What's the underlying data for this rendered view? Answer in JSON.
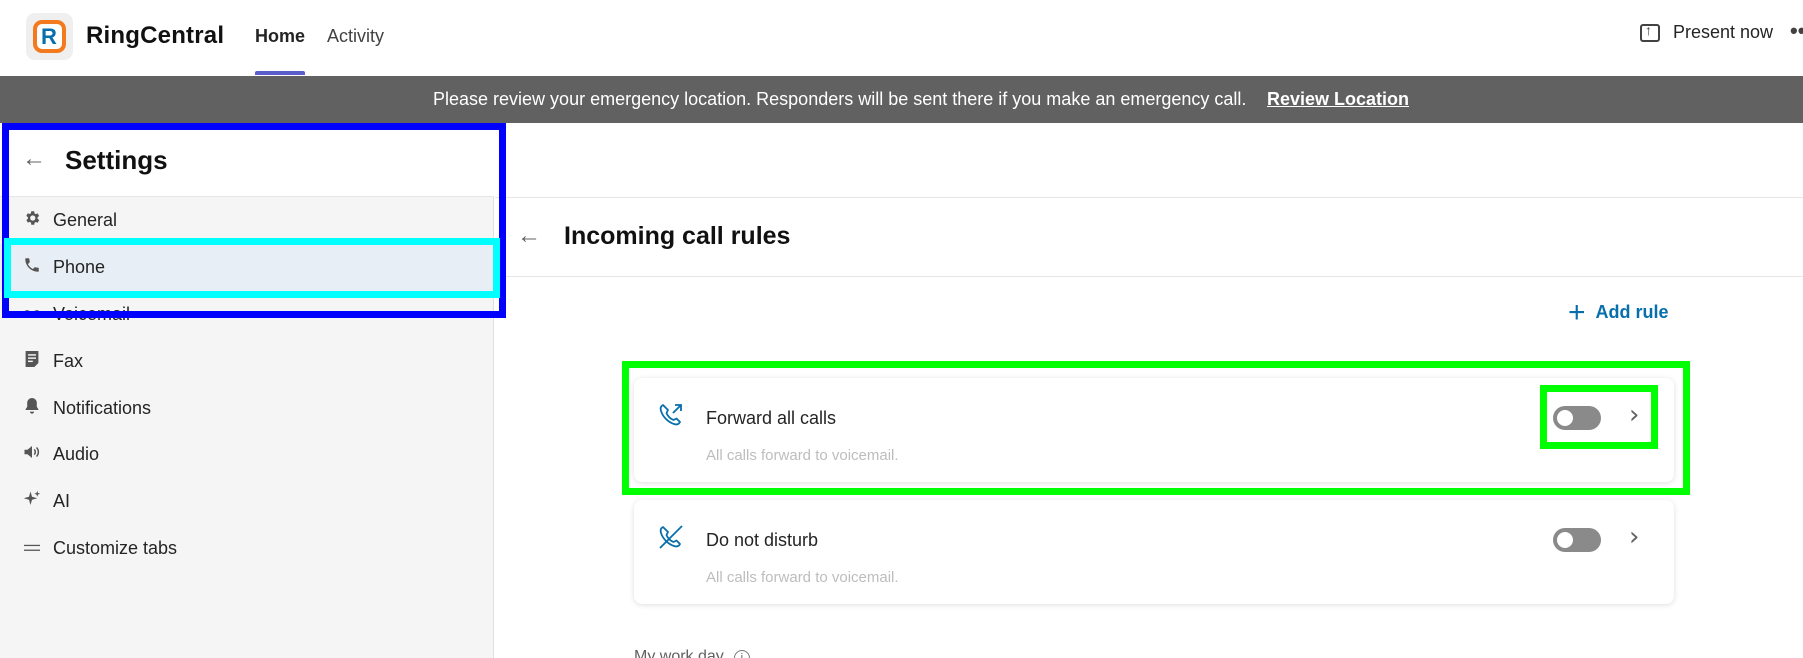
{
  "header": {
    "app_name": "RingCentral",
    "tabs": [
      {
        "label": "Home",
        "active": true
      },
      {
        "label": "Activity",
        "active": false
      }
    ],
    "present_now": "Present now",
    "more": "••"
  },
  "banner": {
    "message": "Please review your emergency location. Responders will be sent there if you make an emergency call.",
    "link": "Review Location"
  },
  "settings": {
    "title": "Settings",
    "back_icon": "arrow-left-icon",
    "items": [
      {
        "label": "General",
        "icon": "gear-icon",
        "active": false
      },
      {
        "label": "Phone",
        "icon": "phone-icon",
        "active": true
      },
      {
        "label": "Voicemail",
        "icon": "voicemail-icon",
        "active": false
      },
      {
        "label": "Fax",
        "icon": "fax-icon",
        "active": false
      },
      {
        "label": "Notifications",
        "icon": "bell-icon",
        "active": false
      },
      {
        "label": "Audio",
        "icon": "speaker-icon",
        "active": false
      },
      {
        "label": "AI",
        "icon": "sparkle-icon",
        "active": false
      },
      {
        "label": "Customize tabs",
        "icon": "lines-icon",
        "active": false
      }
    ]
  },
  "main": {
    "title": "Incoming call rules",
    "add_rule": "Add rule",
    "rules": [
      {
        "title": "Forward all calls",
        "subtitle": "All calls forward to voicemail.",
        "icon": "call-forward-icon",
        "enabled": false
      },
      {
        "title": "Do not disturb",
        "subtitle": "All calls forward to voicemail.",
        "icon": "call-blocked-icon",
        "enabled": false
      }
    ],
    "workday_label": "My work day"
  },
  "colors": {
    "accent": "#066fac",
    "tab_indicator": "#5b5fc7",
    "banner_bg": "#616161",
    "highlight_blue": "#0000ff",
    "highlight_cyan": "#00ffff",
    "highlight_green": "#00ff00"
  }
}
